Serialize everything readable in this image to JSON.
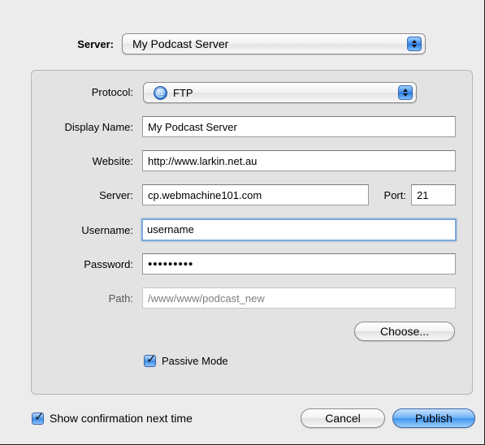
{
  "server_select": {
    "label": "Server:",
    "value": "My Podcast Server"
  },
  "form": {
    "protocol": {
      "label": "Protocol:",
      "value": "FTP",
      "icon": "at-sign-icon"
    },
    "display_name": {
      "label": "Display Name:",
      "value": "My Podcast Server"
    },
    "website": {
      "label": "Website:",
      "value": "http://www.larkin.net.au"
    },
    "server": {
      "label": "Server:",
      "value": "cp.webmachine101.com"
    },
    "port": {
      "label": "Port:",
      "value": "21"
    },
    "username": {
      "label": "Username:",
      "value": "username"
    },
    "password": {
      "label": "Password:",
      "value": "•••••••••"
    },
    "path": {
      "label": "Path:",
      "value": "/www/www/podcast_new"
    },
    "choose_button": "Choose...",
    "passive_mode": {
      "label": "Passive Mode",
      "checked": true
    }
  },
  "footer": {
    "show_confirmation": {
      "label": "Show confirmation next time",
      "checked": true
    },
    "cancel_button": "Cancel",
    "publish_button": "Publish"
  },
  "colors": {
    "accent": "#3f93ec",
    "focus_ring": "#7da8db",
    "background": "#ececec"
  }
}
